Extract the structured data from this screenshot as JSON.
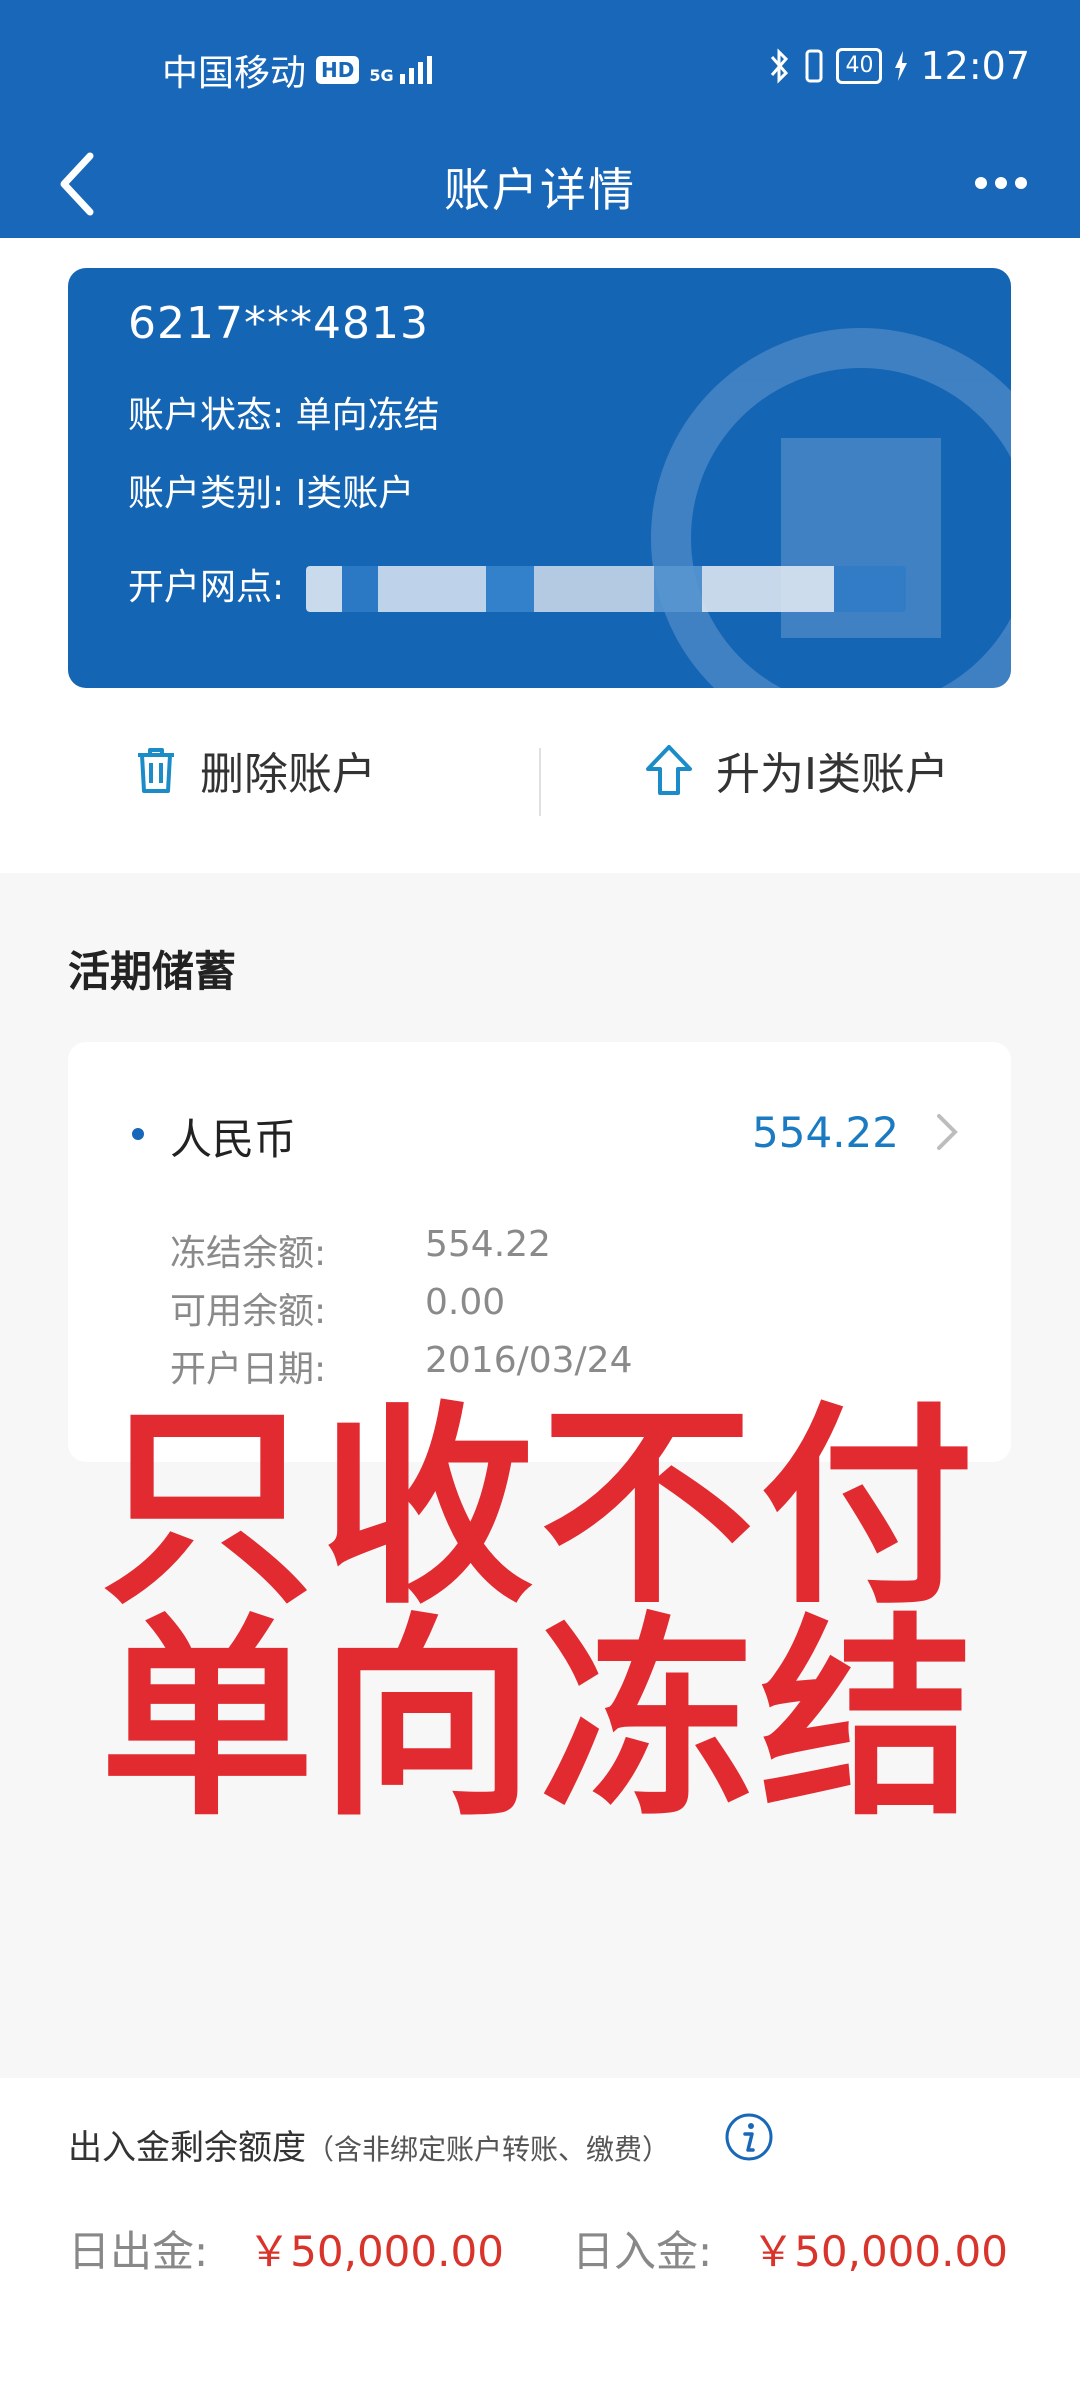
{
  "status_bar": {
    "carrier": "中国移动",
    "hd": "HD",
    "network": "5G",
    "battery": "40",
    "time": "12:07"
  },
  "header": {
    "title": "账户详情"
  },
  "account": {
    "number": "6217***4813",
    "status_label": "账户状态:",
    "status_value": "单向冻结",
    "type_label": "账户类别:",
    "type_value": "Ⅰ类账户",
    "branch_label": "开户网点:"
  },
  "actions": {
    "delete_label": "删除账户",
    "upgrade_label": "升为Ⅰ类账户"
  },
  "savings": {
    "section_title": "活期储蓄",
    "currency": "人民币",
    "amount": "554.22",
    "frozen_label": "冻结余额:",
    "frozen_value": "554.22",
    "available_label": "可用余额:",
    "available_value": "0.00",
    "open_date_label": "开户日期:",
    "open_date_value": "2016/03/24"
  },
  "overlay": {
    "line1": "只收不付",
    "line2": "单向冻结"
  },
  "limits": {
    "title": "出入金剩余额度",
    "subtitle": "（含非绑定账户转账、缴费）",
    "daily_out_label": "日出金:",
    "daily_out_value": "￥50,000.00",
    "daily_in_label": "日入金:",
    "daily_in_value": "￥50,000.00"
  },
  "colors": {
    "primary": "#1867b8",
    "card": "#1565b5",
    "amount": "#1a7ac2",
    "overlay": "#e12b31",
    "limit_value": "#d9342b"
  },
  "icons": [
    "back-arrow-icon",
    "more-dots-icon",
    "trash-icon",
    "upload-arrow-icon",
    "chevron-right-icon",
    "info-icon",
    "bluetooth-icon",
    "signal-icon",
    "battery-icon",
    "charging-icon"
  ]
}
